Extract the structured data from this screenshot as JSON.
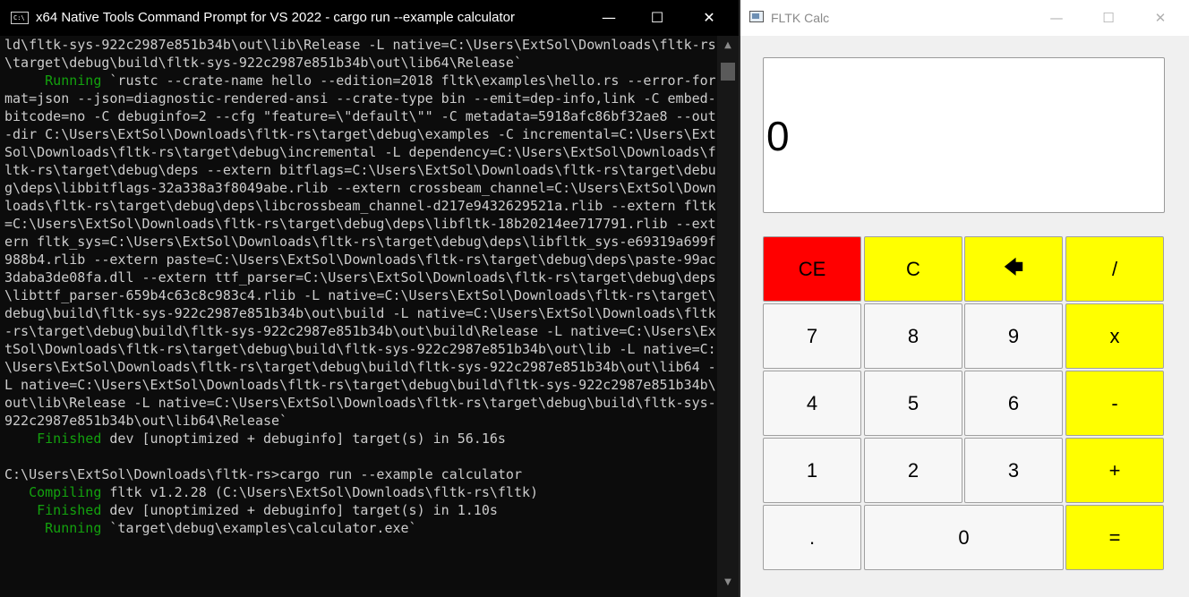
{
  "terminal": {
    "title": "x64 Native Tools Command Prompt for VS 2022 - cargo  run --example calculator",
    "icon_text": "C:\\",
    "controls": {
      "minimize": "—",
      "maximize": "☐",
      "close": "✕"
    },
    "lines": [
      {
        "text": "ld\\fltk-sys-922c2987e851b34b\\out\\lib\\Release -L native=C:\\Users\\ExtSol\\Downloads\\fltk-rs"
      },
      {
        "text": "\\target\\debug\\build\\fltk-sys-922c2987e851b34b\\out\\lib64\\Release`"
      },
      {
        "prefix": "     Running",
        "text": " `rustc --crate-name hello --edition=2018 fltk\\examples\\hello.rs --error-for"
      },
      {
        "text": "mat=json --json=diagnostic-rendered-ansi --crate-type bin --emit=dep-info,link -C embed-"
      },
      {
        "text": "bitcode=no -C debuginfo=2 --cfg \"feature=\\\"default\\\"\" -C metadata=5918afc86bf32ae8 --out"
      },
      {
        "text": "-dir C:\\Users\\ExtSol\\Downloads\\fltk-rs\\target\\debug\\examples -C incremental=C:\\Users\\Ext"
      },
      {
        "text": "Sol\\Downloads\\fltk-rs\\target\\debug\\incremental -L dependency=C:\\Users\\ExtSol\\Downloads\\f"
      },
      {
        "text": "ltk-rs\\target\\debug\\deps --extern bitflags=C:\\Users\\ExtSol\\Downloads\\fltk-rs\\target\\debu"
      },
      {
        "text": "g\\deps\\libbitflags-32a338a3f8049abe.rlib --extern crossbeam_channel=C:\\Users\\ExtSol\\Down"
      },
      {
        "text": "loads\\fltk-rs\\target\\debug\\deps\\libcrossbeam_channel-d217e9432629521a.rlib --extern fltk"
      },
      {
        "text": "=C:\\Users\\ExtSol\\Downloads\\fltk-rs\\target\\debug\\deps\\libfltk-18b20214ee717791.rlib --ext"
      },
      {
        "text": "ern fltk_sys=C:\\Users\\ExtSol\\Downloads\\fltk-rs\\target\\debug\\deps\\libfltk_sys-e69319a699f"
      },
      {
        "text": "988b4.rlib --extern paste=C:\\Users\\ExtSol\\Downloads\\fltk-rs\\target\\debug\\deps\\paste-99ac"
      },
      {
        "text": "3daba3de08fa.dll --extern ttf_parser=C:\\Users\\ExtSol\\Downloads\\fltk-rs\\target\\debug\\deps"
      },
      {
        "text": "\\libttf_parser-659b4c63c8c983c4.rlib -L native=C:\\Users\\ExtSol\\Downloads\\fltk-rs\\target\\"
      },
      {
        "text": "debug\\build\\fltk-sys-922c2987e851b34b\\out\\build -L native=C:\\Users\\ExtSol\\Downloads\\fltk"
      },
      {
        "text": "-rs\\target\\debug\\build\\fltk-sys-922c2987e851b34b\\out\\build\\Release -L native=C:\\Users\\Ex"
      },
      {
        "text": "tSol\\Downloads\\fltk-rs\\target\\debug\\build\\fltk-sys-922c2987e851b34b\\out\\lib -L native=C:"
      },
      {
        "text": "\\Users\\ExtSol\\Downloads\\fltk-rs\\target\\debug\\build\\fltk-sys-922c2987e851b34b\\out\\lib64 -"
      },
      {
        "text": "L native=C:\\Users\\ExtSol\\Downloads\\fltk-rs\\target\\debug\\build\\fltk-sys-922c2987e851b34b\\"
      },
      {
        "text": "out\\lib\\Release -L native=C:\\Users\\ExtSol\\Downloads\\fltk-rs\\target\\debug\\build\\fltk-sys-"
      },
      {
        "text": "922c2987e851b34b\\out\\lib64\\Release`"
      },
      {
        "prefix": "    Finished",
        "text": " dev [unoptimized + debuginfo] target(s) in 56.16s"
      },
      {
        "text": ""
      },
      {
        "text": "C:\\Users\\ExtSol\\Downloads\\fltk-rs>cargo run --example calculator"
      },
      {
        "prefix": "   Compiling",
        "text": " fltk v1.2.28 (C:\\Users\\ExtSol\\Downloads\\fltk-rs\\fltk)"
      },
      {
        "prefix": "    Finished",
        "text": " dev [unoptimized + debuginfo] target(s) in 1.10s"
      },
      {
        "prefix": "     Running",
        "text": " `target\\debug\\examples\\calculator.exe`"
      }
    ]
  },
  "calc": {
    "title": "FLTK Calc",
    "controls": {
      "minimize": "—",
      "maximize": "☐",
      "close": "✕"
    },
    "display": "0",
    "keys": [
      {
        "label": "CE",
        "name": "ce-button",
        "color": "red"
      },
      {
        "label": "C",
        "name": "clear-button",
        "color": "yellow"
      },
      {
        "label": "🡄",
        "name": "backspace-button",
        "color": "yellow",
        "icon": "backspace-arrow-icon"
      },
      {
        "label": "/",
        "name": "divide-button",
        "color": "yellow"
      },
      {
        "label": "7",
        "name": "digit-7-button",
        "color": "white"
      },
      {
        "label": "8",
        "name": "digit-8-button",
        "color": "white"
      },
      {
        "label": "9",
        "name": "digit-9-button",
        "color": "white"
      },
      {
        "label": "x",
        "name": "multiply-button",
        "color": "yellow"
      },
      {
        "label": "4",
        "name": "digit-4-button",
        "color": "white"
      },
      {
        "label": "5",
        "name": "digit-5-button",
        "color": "white"
      },
      {
        "label": "6",
        "name": "digit-6-button",
        "color": "white"
      },
      {
        "label": "-",
        "name": "subtract-button",
        "color": "yellow"
      },
      {
        "label": "1",
        "name": "digit-1-button",
        "color": "white"
      },
      {
        "label": "2",
        "name": "digit-2-button",
        "color": "white"
      },
      {
        "label": "3",
        "name": "digit-3-button",
        "color": "white"
      },
      {
        "label": "+",
        "name": "add-button",
        "color": "yellow"
      },
      {
        "label": ".",
        "name": "decimal-button",
        "color": "white"
      },
      {
        "label": "0",
        "name": "digit-0-button",
        "color": "white"
      },
      {
        "label": "=",
        "name": "equals-button",
        "color": "yellow"
      }
    ]
  },
  "colors": {
    "terminal_green": "#13a10e",
    "key_yellow": "#ffff00",
    "key_red": "#ff0000"
  }
}
